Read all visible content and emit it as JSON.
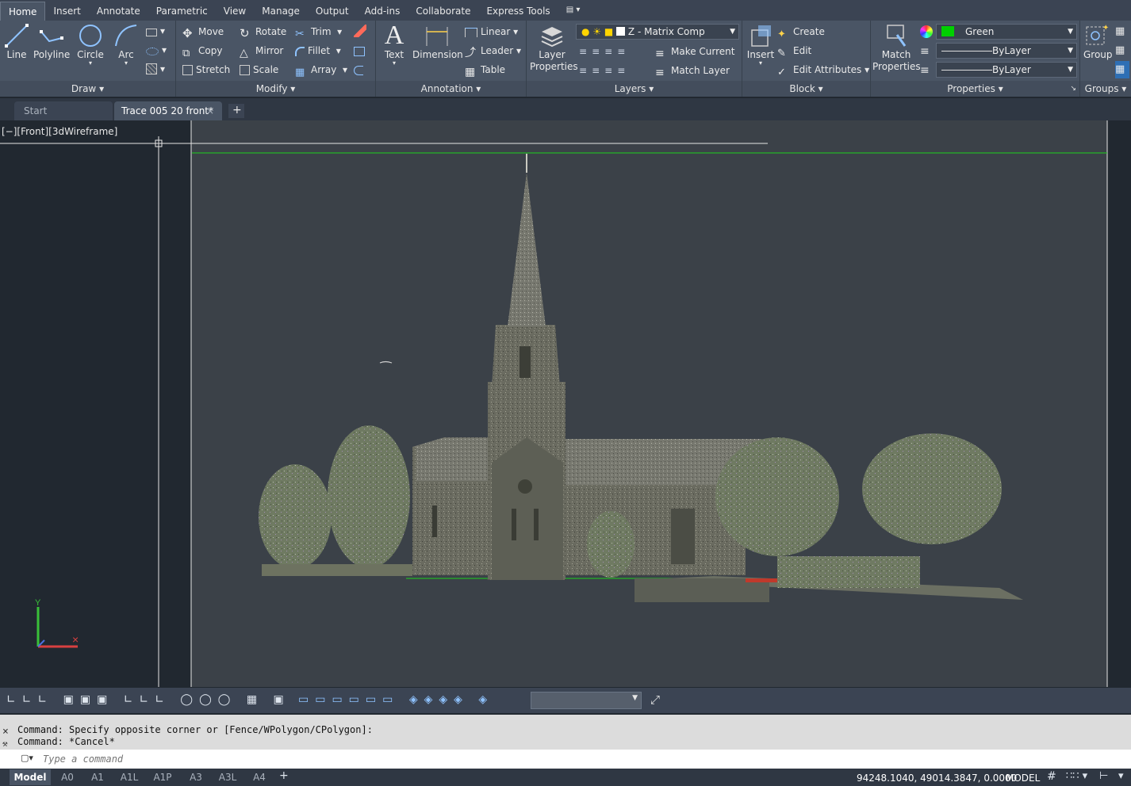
{
  "menu_tabs": [
    "Home",
    "Insert",
    "Annotate",
    "Parametric",
    "View",
    "Manage",
    "Output",
    "Add-ins",
    "Collaborate",
    "Express Tools"
  ],
  "active_tab": "Home",
  "draw": {
    "line": "Line",
    "polyline": "Polyline",
    "circle": "Circle",
    "arc": "Arc",
    "title": "Draw"
  },
  "modify": {
    "move": "Move",
    "rotate": "Rotate",
    "trim": "Trim",
    "copy": "Copy",
    "mirror": "Mirror",
    "fillet": "Fillet",
    "stretch": "Stretch",
    "scale": "Scale",
    "array": "Array",
    "title": "Modify"
  },
  "annotation": {
    "text": "Text",
    "dimension": "Dimension",
    "linear": "Linear",
    "leader": "Leader",
    "table": "Table",
    "title": "Annotation"
  },
  "layers": {
    "layer_properties": "Layer Properties",
    "current_layer": "Z - Matrix Comp",
    "make_current": "Make Current",
    "match_layer": "Match Layer",
    "title": "Layers"
  },
  "block": {
    "insert": "Insert",
    "create": "Create",
    "edit": "Edit",
    "edit_attributes": "Edit Attributes",
    "title": "Block"
  },
  "properties": {
    "match_properties": "Match Properties",
    "color": "Green",
    "linetype": "ByLayer",
    "lineweight": "ByLayer",
    "title": "Properties",
    "color_hex": "#00d000"
  },
  "groups": {
    "group": "Group",
    "title": "Groups"
  },
  "doc_tabs": {
    "start": "Start",
    "active": "Trace 005 20 front*"
  },
  "viewport_label": "[−][Front][3dWireframe]",
  "ucs": {
    "y": "Y"
  },
  "command": {
    "line1": "Command: Specify opposite corner or [Fence/WPolygon/CPolygon]:",
    "line2": "Command: *Cancel*",
    "placeholder": "Type a command"
  },
  "layout_tabs": [
    "Model",
    "A0",
    "A1",
    "A1L",
    "A1P",
    "A3",
    "A3L",
    "A4"
  ],
  "status": {
    "coords": "94248.1040, 49014.3847, 0.0000",
    "mode": "MODEL"
  }
}
